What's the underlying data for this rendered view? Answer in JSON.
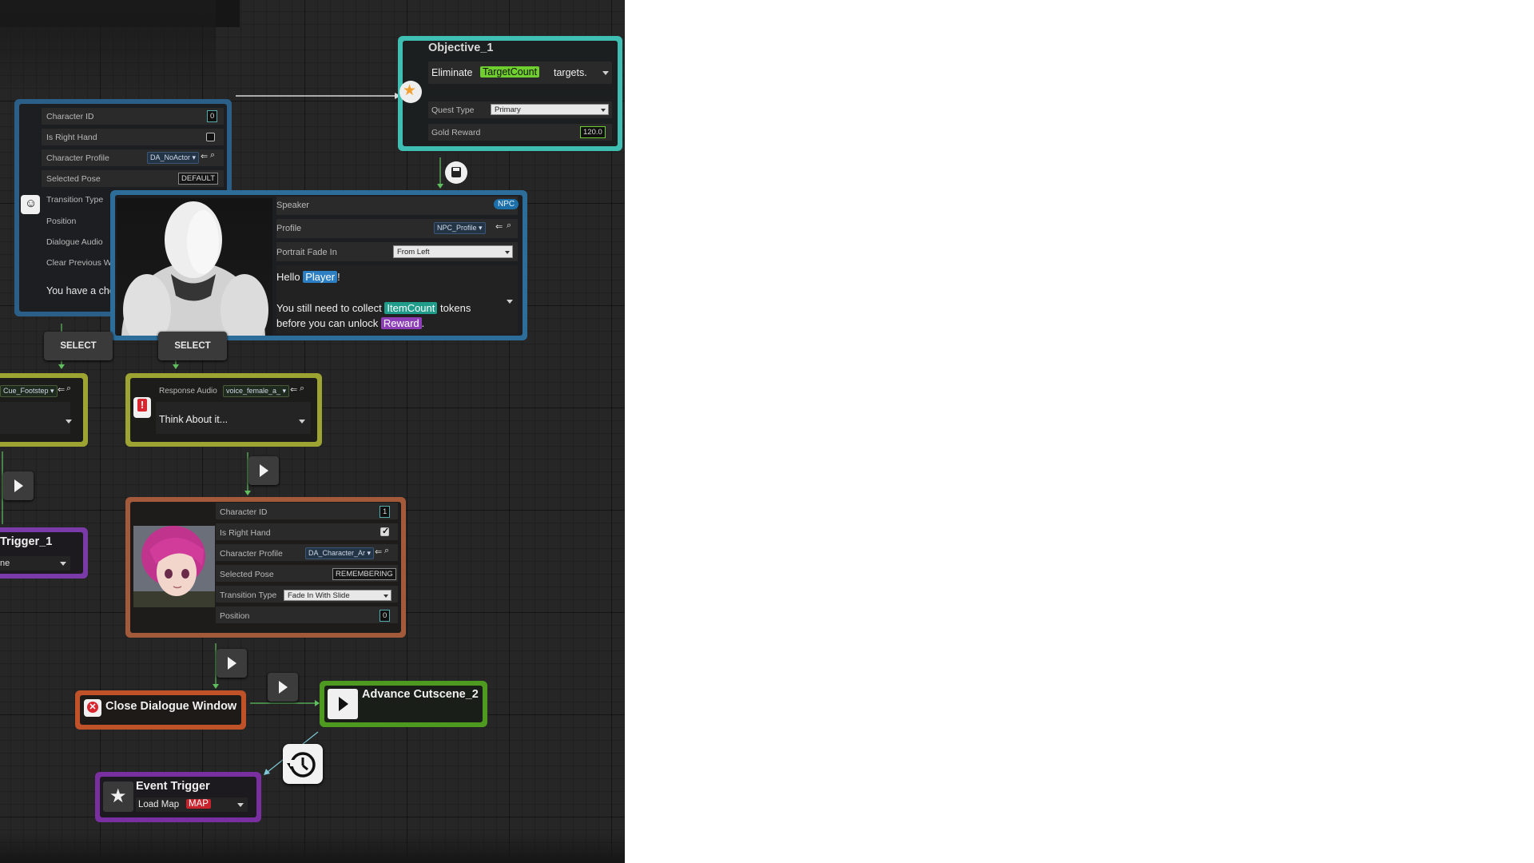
{
  "objective": {
    "title": "Objective_1",
    "text_pre": "Eliminate",
    "variable": "TargetCount",
    "text_post": "targets.",
    "quest_type_label": "Quest Type",
    "quest_type_value": "Primary",
    "gold_reward_label": "Gold Reward",
    "gold_reward_value": "120.0"
  },
  "char_node_1": {
    "character_id_label": "Character ID",
    "character_id_value": "0",
    "is_right_hand_label": "Is Right Hand",
    "character_profile_label": "Character Profile",
    "character_profile_value": "DA_NoActor",
    "selected_pose_label": "Selected Pose",
    "selected_pose_value": "DEFAULT",
    "transition_type_label": "Transition Type",
    "position_label": "Position",
    "dialogue_audio_label": "Dialogue Audio",
    "clear_previous_label": "Clear Previous W",
    "choice_text": "You have a cho"
  },
  "speaker_node": {
    "speaker_label": "Speaker",
    "speaker_value": "NPC",
    "profile_label": "Profile",
    "profile_value": "NPC_Profile",
    "portrait_fade_label": "Portrait Fade In",
    "portrait_fade_value": "From Left",
    "line1_pre": "Hello",
    "line1_var": "Player",
    "line1_post": "!",
    "line2_pre": "You still need to collect",
    "line2_var": "ItemCount",
    "line2_post": "tokens",
    "line3_pre": "before you can unlock",
    "line3_var": "Reward",
    "line3_post": "."
  },
  "select_buttons": [
    "SELECT",
    "SELECT"
  ],
  "response_left": {
    "audio_value": "Cue_Footstep"
  },
  "response_right": {
    "audio_label": "Response Audio",
    "audio_value": "voice_female_a_",
    "text": "Think About it..."
  },
  "trigger_partial": {
    "title": "Trigger_1",
    "value": "ne"
  },
  "char_node_2": {
    "character_id_label": "Character ID",
    "character_id_value": "1",
    "is_right_hand_label": "Is Right Hand",
    "character_profile_label": "Character Profile",
    "character_profile_value": "DA_Character_Ar",
    "selected_pose_label": "Selected Pose",
    "selected_pose_value": "REMEMBERING",
    "transition_type_label": "Transition Type",
    "transition_type_value": "Fade In With Slide",
    "position_label": "Position",
    "position_value": "0"
  },
  "close_dialogue": {
    "title": "Close Dialogue Window"
  },
  "advance_cutscene": {
    "title": "Advance Cutscene_2"
  },
  "event_trigger": {
    "title": "Event Trigger",
    "action": "Load Map",
    "tag": "MAP"
  },
  "colors": {
    "objective_border": "#3fbfb3",
    "dialogue_border": "#2c6d9a",
    "response_border": "#9ea431",
    "trigger_border": "#7a3aa8",
    "char2_border": "#a35a3a",
    "close_border": "#c0522a",
    "advance_border": "#4e9a21",
    "event_border": "#7a2fa0",
    "wire_green": "#5fbf5f"
  },
  "icons": [
    "star-icon",
    "save-icon",
    "smiley-icon",
    "alert-icon",
    "play-icon",
    "close-x-icon",
    "history-icon",
    "search-icon",
    "back-arrow-icon"
  ]
}
